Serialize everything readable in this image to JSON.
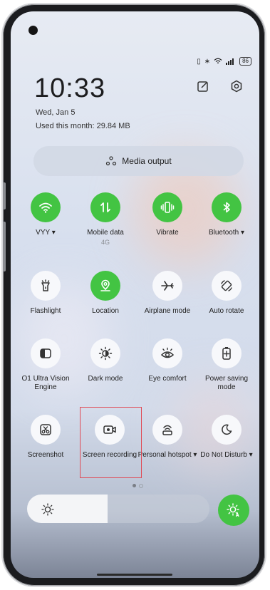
{
  "status_bar": {
    "battery": "86"
  },
  "clock": {
    "time": "10:33",
    "date": "Wed, Jan 5",
    "usage": "Used this month: 29.84 MB"
  },
  "media_output": {
    "label": "Media output"
  },
  "tiles": [
    {
      "label": "VYY",
      "sub": "",
      "icon": "wifi-icon",
      "on": true
    },
    {
      "label": "Mobile data",
      "sub": "4G",
      "icon": "mobile-data-icon",
      "on": true
    },
    {
      "label": "Vibrate",
      "sub": "",
      "icon": "vibrate-icon",
      "on": true
    },
    {
      "label": "Bluetooth",
      "sub": "",
      "icon": "bluetooth-icon",
      "on": true
    },
    {
      "label": "Flashlight",
      "sub": "",
      "icon": "flashlight-icon",
      "on": false
    },
    {
      "label": "Location",
      "sub": "",
      "icon": "location-icon",
      "on": true
    },
    {
      "label": "Airplane mode",
      "sub": "",
      "icon": "airplane-icon",
      "on": false
    },
    {
      "label": "Auto rotate",
      "sub": "",
      "icon": "rotate-icon",
      "on": false
    },
    {
      "label": "O1 Ultra Vision Engine",
      "sub": "",
      "icon": "vision-engine-icon",
      "on": false
    },
    {
      "label": "Dark mode",
      "sub": "",
      "icon": "dark-mode-icon",
      "on": false
    },
    {
      "label": "Eye comfort",
      "sub": "",
      "icon": "eye-icon",
      "on": false
    },
    {
      "label": "Power saving mode",
      "sub": "",
      "icon": "battery-saver-icon",
      "on": false
    },
    {
      "label": "Screenshot",
      "sub": "",
      "icon": "screenshot-icon",
      "on": false
    },
    {
      "label": "Screen recording",
      "sub": "",
      "icon": "screen-recording-icon",
      "on": false
    },
    {
      "label": "Personal hotspot",
      "sub": "",
      "icon": "hotspot-icon",
      "on": false
    },
    {
      "label": "Do Not Disturb",
      "sub": "",
      "icon": "moon-icon",
      "on": false
    }
  ],
  "brightness": {
    "level": 0.44
  },
  "colors": {
    "accent": "#43c443",
    "highlight": "#e04a55"
  }
}
